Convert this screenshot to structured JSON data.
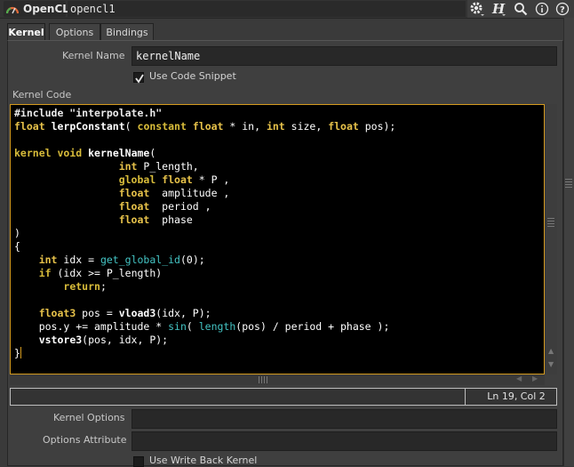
{
  "header": {
    "node_type": "OpenCL",
    "node_name": "opencl1",
    "tools": [
      "gear-icon",
      "h-help-icon",
      "search-icon",
      "info-icon",
      "help-icon"
    ]
  },
  "tabs": [
    {
      "label": "Kernel",
      "active": true
    },
    {
      "label": "Options",
      "active": false
    },
    {
      "label": "Bindings",
      "active": false
    }
  ],
  "kernel_name": {
    "label": "Kernel Name",
    "value": "kernelName"
  },
  "use_code_snippet": {
    "label": "Use Code Snippet",
    "checked": true
  },
  "kernel_code": {
    "label": "Kernel Code",
    "lines": [
      "#include \"interpolate.h\"",
      "float lerpConstant( constant float * in, int size, float pos);",
      "",
      "kernel void kernelName(",
      "                 int P_length,",
      "                 global float * P ,",
      "                 float  amplitude ,",
      "                 float  period ,",
      "                 float  phase",
      ")",
      "{",
      "    int idx = get_global_id(0);",
      "    if (idx >= P_length)",
      "        return;",
      "",
      "    float3 pos = vload3(idx, P);",
      "    pos.y += amplitude * sin( length(pos) / period + phase );",
      "    vstore3(pos, idx, P);",
      "}"
    ]
  },
  "status": {
    "cursor": "Ln 19, Col 2"
  },
  "kernel_options": {
    "label": "Kernel Options",
    "value": ""
  },
  "options_attribute": {
    "label": "Options Attribute",
    "value": ""
  },
  "use_write_back_kernel": {
    "label": "Use Write Back Kernel",
    "checked": false
  },
  "colors": {
    "accent_border": "#d49a1e",
    "keyword": "#d8bc3a",
    "function": "#44c4c4",
    "background": "#3a3a3a"
  }
}
